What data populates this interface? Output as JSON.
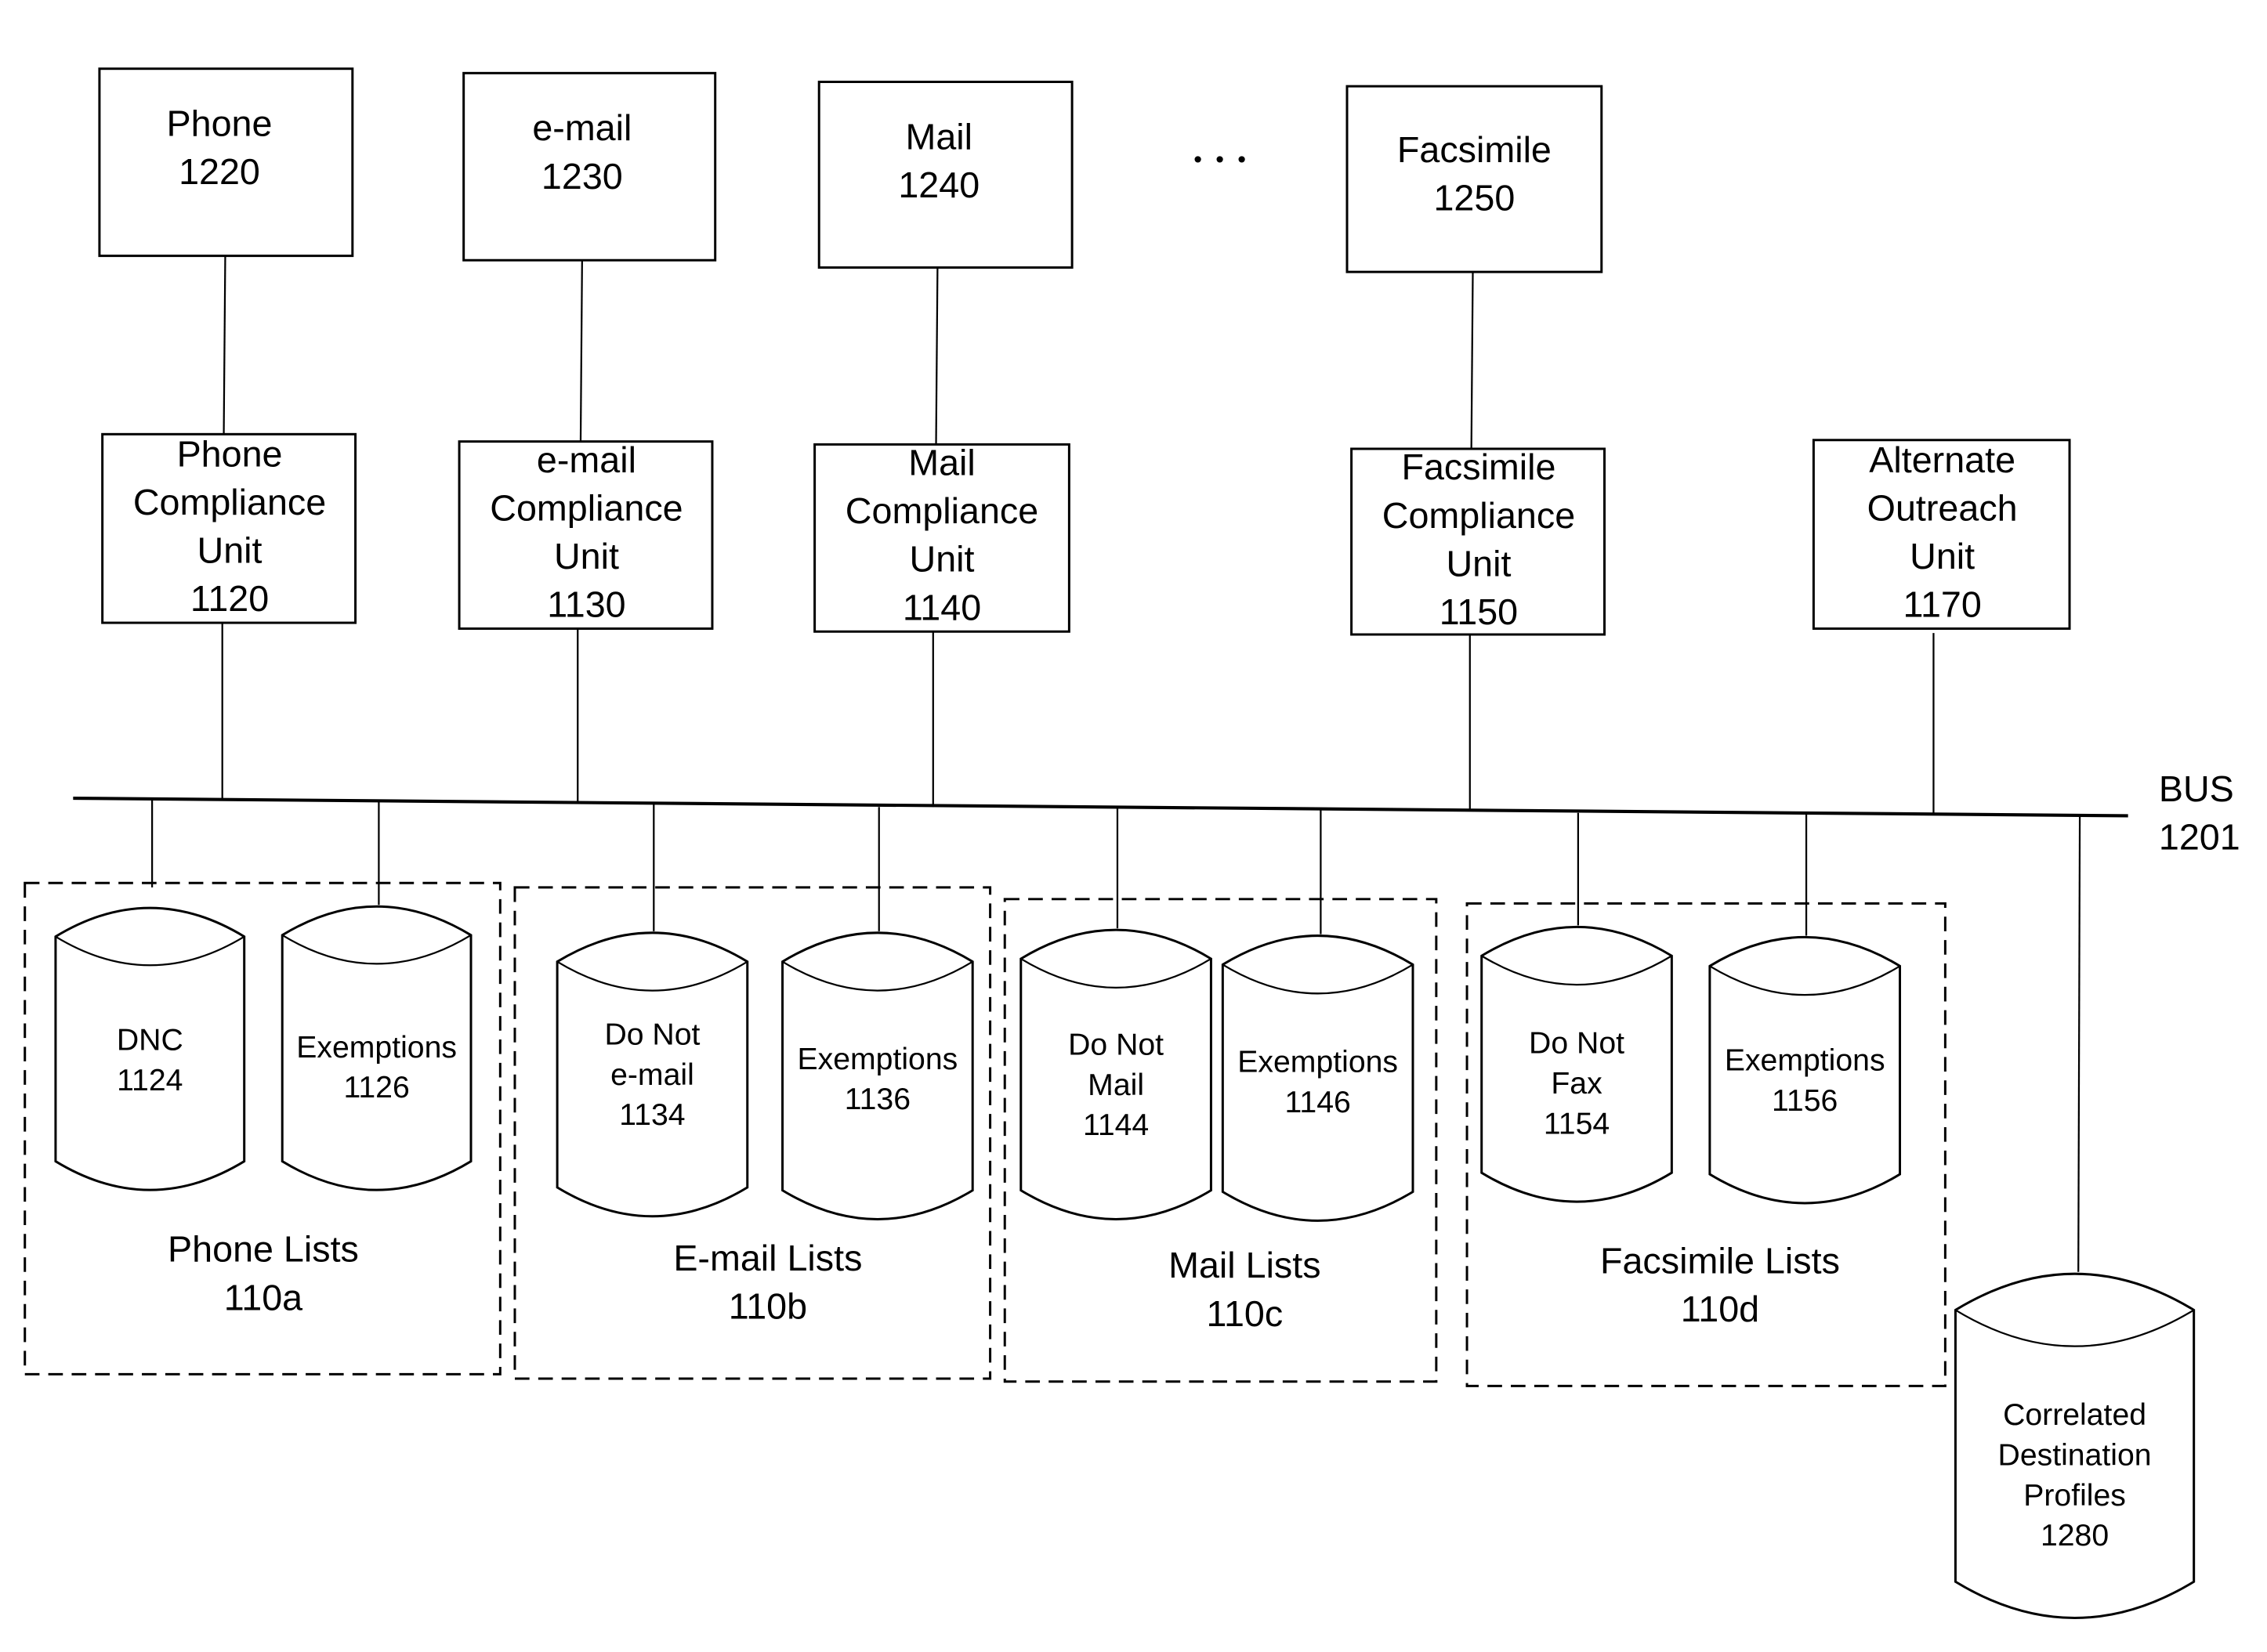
{
  "diagram": {
    "bus": {
      "name": "BUS",
      "id": "1201"
    },
    "ellipsis": "...",
    "channels": [
      {
        "key": "phone",
        "label": "Phone",
        "id": "1220"
      },
      {
        "key": "email",
        "label": "e-mail",
        "id": "1230"
      },
      {
        "key": "mail",
        "label": "Mail",
        "id": "1240"
      },
      {
        "key": "fax",
        "label": "Facsimile",
        "id": "1250"
      }
    ],
    "compliance_units": [
      {
        "key": "phone",
        "lines": [
          "Phone",
          "Compliance",
          "Unit"
        ],
        "id": "1120"
      },
      {
        "key": "email",
        "lines": [
          "e-mail",
          "Compliance",
          "Unit"
        ],
        "id": "1130"
      },
      {
        "key": "mail",
        "lines": [
          "Mail",
          "Compliance",
          "Unit"
        ],
        "id": "1140"
      },
      {
        "key": "fax",
        "lines": [
          "Facsimile",
          "Compliance",
          "Unit"
        ],
        "id": "1150"
      },
      {
        "key": "alternate",
        "lines": [
          "Alternate",
          "Outreach",
          "Unit"
        ],
        "id": "1170"
      }
    ],
    "list_groups": [
      {
        "key": "phone",
        "title": "Phone Lists",
        "id": "110a",
        "databases": [
          {
            "lines": [
              "DNC"
            ],
            "id": "1124"
          },
          {
            "lines": [
              "Exemptions"
            ],
            "id": "1126"
          }
        ]
      },
      {
        "key": "email",
        "title": "E-mail Lists",
        "id": "110b",
        "databases": [
          {
            "lines": [
              "Do Not",
              "e-mail"
            ],
            "id": "1134"
          },
          {
            "lines": [
              "Exemptions"
            ],
            "id": "1136"
          }
        ]
      },
      {
        "key": "mail",
        "title": "Mail Lists",
        "id": "110c",
        "databases": [
          {
            "lines": [
              "Do Not",
              "Mail"
            ],
            "id": "1144"
          },
          {
            "lines": [
              "Exemptions"
            ],
            "id": "1146"
          }
        ]
      },
      {
        "key": "fax",
        "title": "Facsimile Lists",
        "id": "110d",
        "databases": [
          {
            "lines": [
              "Do Not",
              "Fax"
            ],
            "id": "1154"
          },
          {
            "lines": [
              "Exemptions"
            ],
            "id": "1156"
          }
        ]
      }
    ],
    "profiles_db": {
      "lines": [
        "Correlated",
        "Destination",
        "Profiles"
      ],
      "id": "1280"
    }
  }
}
